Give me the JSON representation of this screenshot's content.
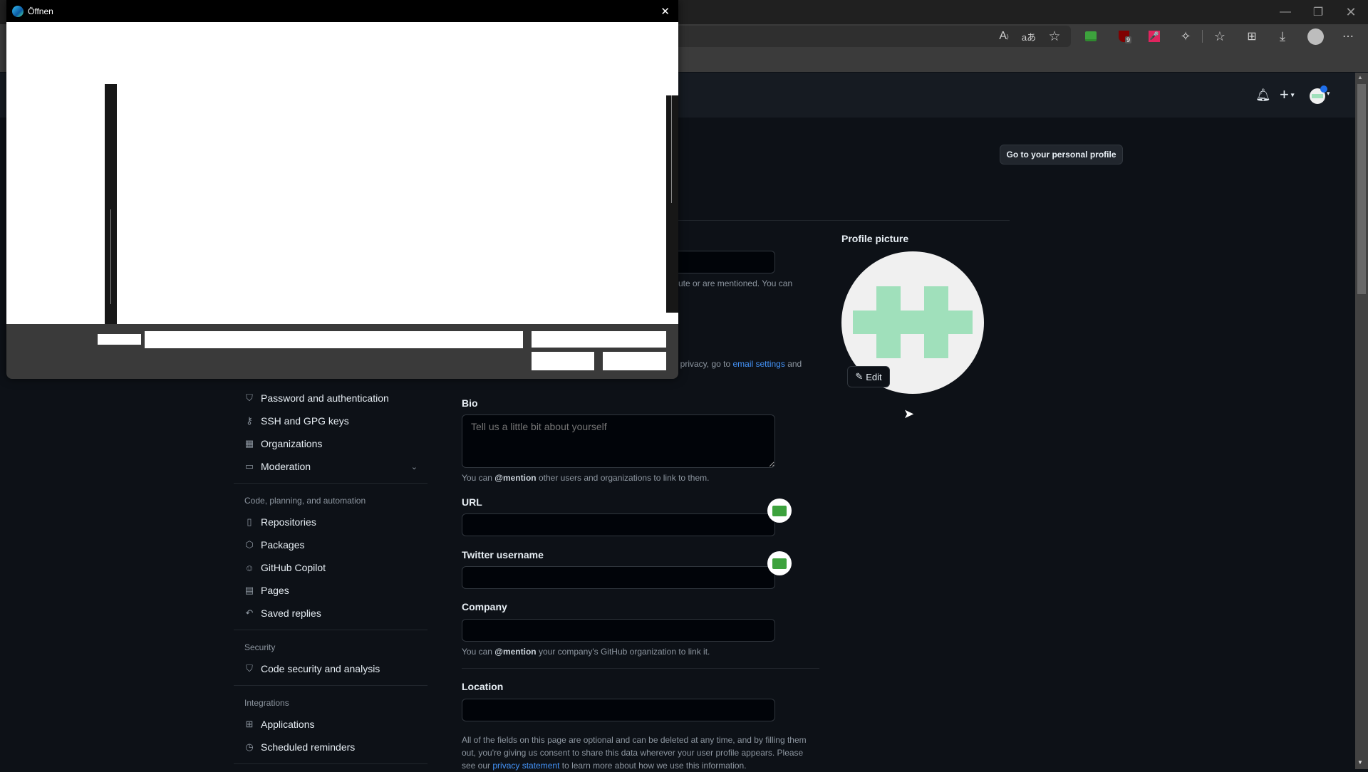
{
  "browser": {
    "toolbar_icons": [
      "read-aloud-icon",
      "translate-icon",
      "add-favorite-icon",
      "roboform-extension-icon",
      "ublock-extension-icon",
      "voice-extension-icon",
      "extensions-icon",
      "favorites-icon",
      "collections-icon",
      "downloads-icon",
      "profile-icon",
      "more-icon"
    ],
    "ublock_badge": "9",
    "window_controls": {
      "minimize": "—",
      "restore": "❐",
      "close": "✕"
    },
    "accent_colors": {
      "roboform": "#3da23d",
      "ublock": "#800000",
      "voice": "#e0245e"
    }
  },
  "dialog": {
    "title": "Öffnen",
    "close": "✕"
  },
  "github_header": {
    "notifications": "bell-icon",
    "create_new": "+",
    "avatar_dot_color": "#1f6feb"
  },
  "page": {
    "go_profile_button": "Go to your personal profile",
    "partial_texts": {
      "public_email_help": "ute or are mentioned. You can",
      "email_privacy_prefix": "il privacy, go to ",
      "email_settings_link": "email settings",
      "email_privacy_suffix": " and"
    },
    "profile_picture": {
      "label": "Profile picture",
      "edit_button": "Edit",
      "avatar_bg": "#f0f0f0",
      "avatar_fg": "#a0e0bb"
    },
    "bio": {
      "label": "Bio",
      "placeholder": "Tell us a little bit about yourself",
      "note_prefix": "You can ",
      "note_bold": "@mention",
      "note_suffix": " other users and organizations to link to them."
    },
    "url": {
      "label": "URL",
      "value": ""
    },
    "twitter": {
      "label": "Twitter username",
      "value": ""
    },
    "company": {
      "label": "Company",
      "value": "",
      "note_prefix": "You can ",
      "note_bold": "@mention",
      "note_suffix": " your company's GitHub organization to link it."
    },
    "location": {
      "label": "Location",
      "value": ""
    },
    "footer_note": {
      "prefix": "All of the fields on this page are optional and can be deleted at any time, and by filling them out, you're giving us consent to share this data wherever your user profile appears. Please see our ",
      "link": "privacy statement",
      "suffix": " to learn more about how we use this information."
    }
  },
  "sidebar": {
    "items_top": [
      {
        "label": "Password and authentication",
        "icon": "shield-lock-icon"
      },
      {
        "label": "SSH and GPG keys",
        "icon": "key-icon"
      },
      {
        "label": "Organizations",
        "icon": "organization-icon"
      },
      {
        "label": "Moderation",
        "icon": "report-icon"
      }
    ],
    "code_heading": "Code, planning, and automation",
    "code_items": [
      {
        "label": "Repositories",
        "icon": "repo-icon"
      },
      {
        "label": "Packages",
        "icon": "package-icon"
      },
      {
        "label": "GitHub Copilot",
        "icon": "copilot-icon"
      },
      {
        "label": "Pages",
        "icon": "browser-icon"
      },
      {
        "label": "Saved replies",
        "icon": "reply-icon"
      }
    ],
    "security_heading": "Security",
    "security_items": [
      {
        "label": "Code security and analysis",
        "icon": "shield-icon"
      }
    ],
    "integrations_heading": "Integrations",
    "integrations_items": [
      {
        "label": "Applications",
        "icon": "apps-icon"
      },
      {
        "label": "Scheduled reminders",
        "icon": "clock-icon"
      }
    ]
  }
}
